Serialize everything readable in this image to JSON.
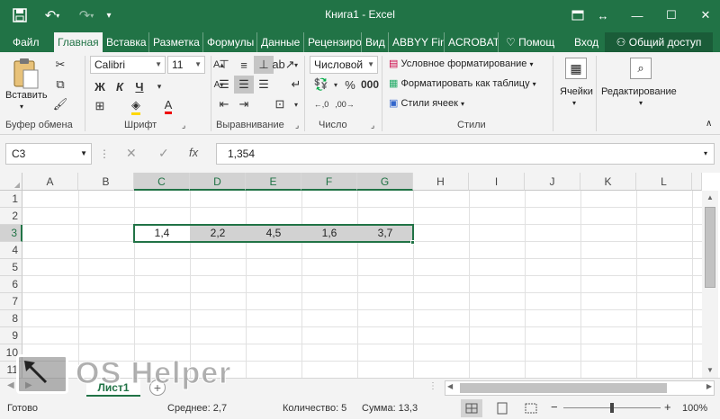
{
  "window": {
    "title": "Книга1 - Excel"
  },
  "tabs": [
    "Файл",
    "Главная",
    "Вставка",
    "Разметка с",
    "Формулы",
    "Данные",
    "Рецензиро",
    "Вид",
    "ABBYY Fin",
    "ACROBAT",
    "♡ Помощ",
    "Вход",
    "⚇ Общий доступ"
  ],
  "ribbon": {
    "clipboard": {
      "paste": "Вставить",
      "group": "Буфер обмена"
    },
    "font": {
      "name": "Calibri",
      "size": "11",
      "bold": "Ж",
      "italic": "К",
      "underline": "Ч",
      "group": "Шрифт"
    },
    "alignment": {
      "group": "Выравнивание"
    },
    "number": {
      "format": "Числовой",
      "group": "Число"
    },
    "styles": {
      "conditional": "Условное форматирование",
      "table": "Форматировать как таблицу",
      "cell": "Стили ячеек",
      "group": "Стили"
    },
    "cells": {
      "label": "Ячейки"
    },
    "editing": {
      "label": "Редактирование"
    }
  },
  "formula_bar": {
    "name_box": "C3",
    "fx": "fx",
    "value": "1,354"
  },
  "grid": {
    "columns": [
      "A",
      "B",
      "C",
      "D",
      "E",
      "F",
      "G",
      "H",
      "I",
      "J",
      "K",
      "L"
    ],
    "rows": [
      "1",
      "2",
      "3",
      "4",
      "5",
      "6",
      "7",
      "8",
      "9",
      "10",
      "11"
    ],
    "row3_values": [
      "1,4",
      "2,2",
      "4,5",
      "1,6",
      "3,7"
    ]
  },
  "sheet": {
    "name": "Лист1"
  },
  "status": {
    "ready": "Готово",
    "average": "Среднее: 2,7",
    "count": "Количество: 5",
    "sum": "Сумма: 13,3",
    "zoom": "100%"
  },
  "watermark": "OS Helper",
  "colors": {
    "accent": "#217346",
    "selection": "#d2d2d2"
  }
}
